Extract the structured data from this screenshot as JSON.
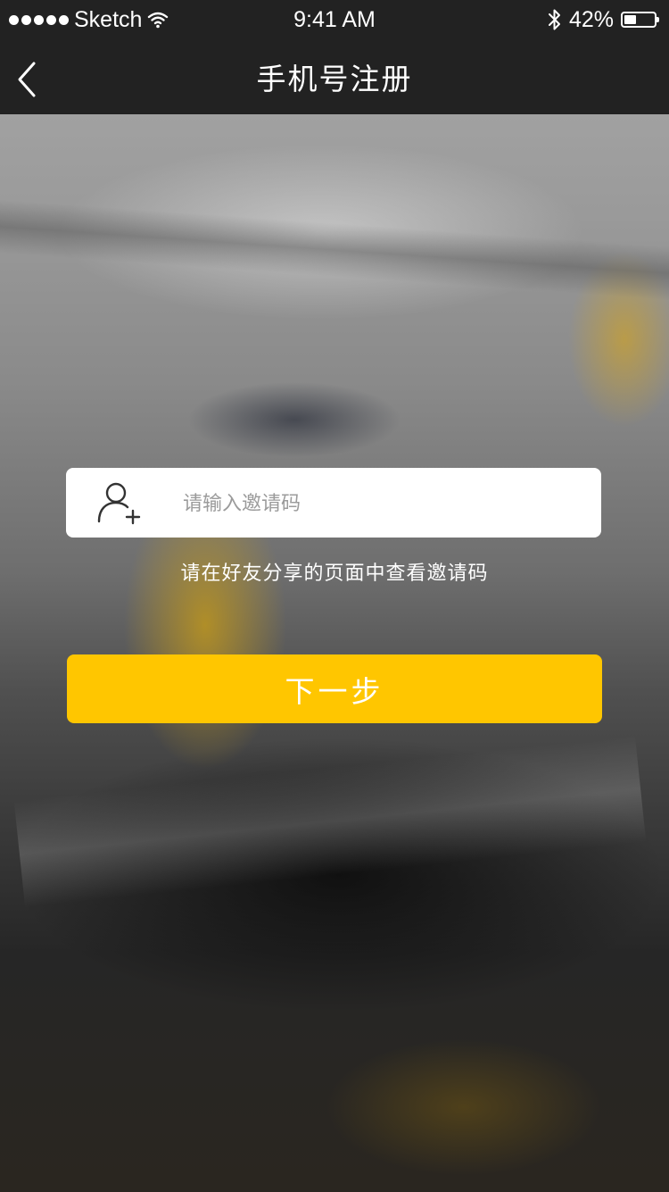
{
  "status_bar": {
    "carrier": "Sketch",
    "time": "9:41 AM",
    "battery_percent_label": "42%",
    "battery_level": 0.42,
    "icons": [
      "signal-dots-icon",
      "wifi-icon",
      "bluetooth-icon",
      "battery-icon"
    ]
  },
  "nav": {
    "title": "手机号注册",
    "back_icon": "chevron-left-icon"
  },
  "invite": {
    "icon": "user-add-icon",
    "placeholder": "请输入邀请码",
    "value": "",
    "hint": "请在好友分享的页面中查看邀请码"
  },
  "actions": {
    "next_label": "下一步"
  },
  "colors": {
    "nav_background": "#222222",
    "accent": "#ffc600",
    "input_background": "#ffffff",
    "placeholder": "#9b9b9b",
    "text_light": "#ffffff"
  }
}
